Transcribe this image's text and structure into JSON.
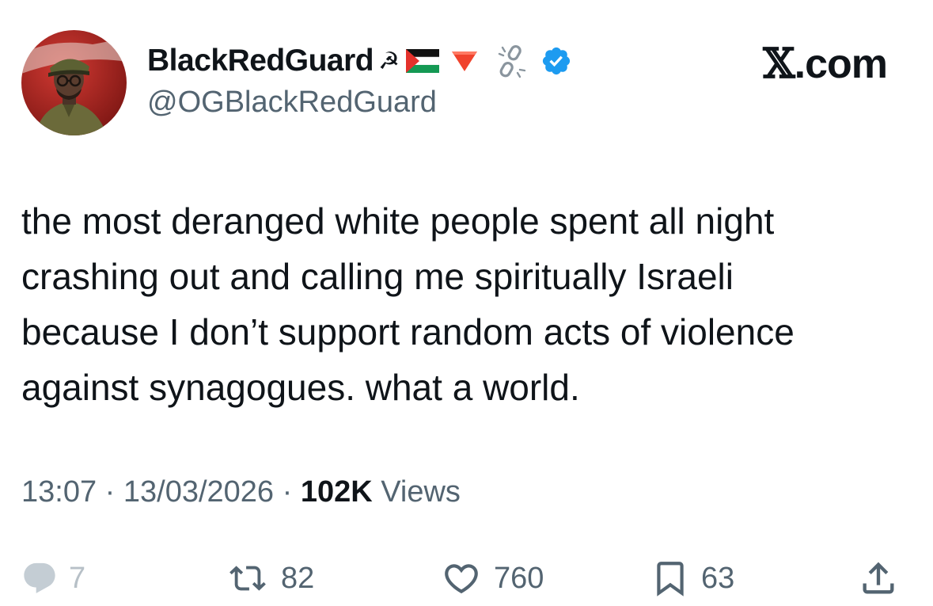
{
  "author": {
    "display_name": "BlackRedGuard",
    "badges": [
      "hammer-sickle-icon",
      "palestine-flag-icon",
      "red-triangle-icon",
      "broken-chain-icon",
      "verified-badge-icon"
    ],
    "hammer_sickle_glyph": "☭",
    "handle": "@OGBlackRedGuard"
  },
  "site": {
    "logo_x": "𝕏",
    "logo_suffix": ".com"
  },
  "tweet": {
    "lines": [
      "the most deranged white people spent all night",
      "crashing out and calling me spiritually Israeli",
      "because I don’t support random acts of violence",
      "against synagogues. what a world."
    ]
  },
  "meta": {
    "time": "13:07",
    "sep1": " · ",
    "date": "13/03/2026",
    "sep2": " · ",
    "views_count": "102K",
    "views_label": " Views"
  },
  "actions": {
    "replies": "7",
    "reposts": "82",
    "likes": "760",
    "bookmarks": "63"
  },
  "colors": {
    "verified": "#1d9bf0",
    "text_primary": "#0f1419",
    "text_secondary": "#536471",
    "flag_red": "#e4312b",
    "flag_green": "#149954"
  }
}
